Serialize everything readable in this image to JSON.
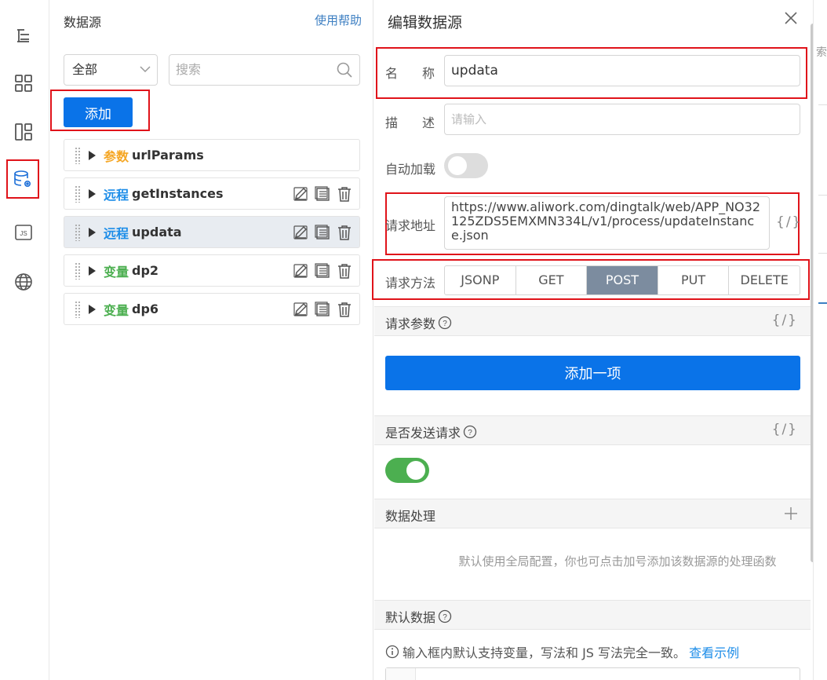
{
  "rail": {
    "icons": [
      "outline-icon",
      "components-icon",
      "page-template-icon",
      "datasource-icon",
      "js-icon",
      "global-icon"
    ],
    "js_label": "JS"
  },
  "ds_panel": {
    "title": "数据源",
    "help": "使用帮助",
    "filter": "全部",
    "search_placeholder": "搜索",
    "add_label": "添加",
    "items": [
      {
        "tag": "参数",
        "kind": "param",
        "name": "urlParams"
      },
      {
        "tag": "远程",
        "kind": "remote",
        "name": "getInstances"
      },
      {
        "tag": "远程",
        "kind": "remote",
        "name": "updata"
      },
      {
        "tag": "变量",
        "kind": "var",
        "name": "dp2"
      },
      {
        "tag": "变量",
        "kind": "var",
        "name": "dp6"
      }
    ]
  },
  "edit": {
    "title": "编辑数据源",
    "name_label_a": "名",
    "name_label_b": "称",
    "name_value": "updata",
    "desc_label_a": "描",
    "desc_label_b": "述",
    "desc_placeholder": "请输入",
    "autoload_label": "自动加载",
    "url_label": "请求地址",
    "url_value": "https://www.aliwork.com/dingtalk/web/APP_NO32125ZDS5EMXMN334L/v1/process/updateInstance.json",
    "brace": "{/}",
    "method_label": "请求方法",
    "methods": [
      "JSONP",
      "GET",
      "POST",
      "PUT",
      "DELETE"
    ],
    "method_selected": "POST",
    "params_title": "请求参数",
    "add_item": "添加一项",
    "send_title": "是否发送请求",
    "process_title": "数据处理",
    "process_hint": "默认使用全局配置，你也可点击加号添加该数据源的处理函数",
    "default_title": "默认数据",
    "default_note": "输入框内默认支持变量，写法和 JS 写法完全一致。",
    "default_link": "查看示例"
  },
  "right_edge": {
    "snippet": "索"
  },
  "colors": {
    "primary": "#0a73e8",
    "highlight": "#e0131a",
    "selected_method": "#7c8c9f",
    "toggle_on": "#4caf50"
  }
}
